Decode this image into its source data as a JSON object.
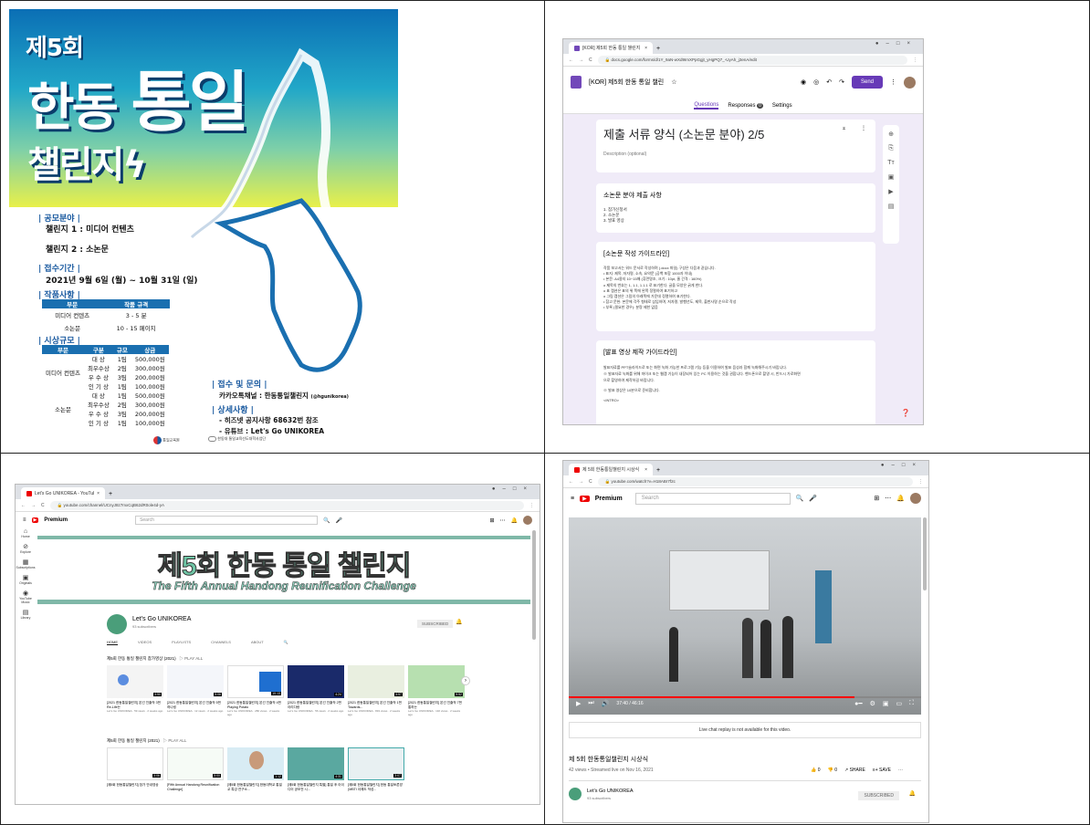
{
  "poster": {
    "round": "제5회",
    "title_a": "한동",
    "title_b": "통일",
    "title_c": "챌린지",
    "sec1": "| 공모분야 |",
    "ch1": "챌린지 1 : 미디어 컨텐츠",
    "ch2": "챌린지 2 : 소논문",
    "sec2": "| 접수기간 |",
    "period": "2021년 9월 6일 (월) ~ 10월 31일 (일)",
    "sec3": "| 작품사항 |",
    "spec_headers": [
      "부문",
      "작품 규격"
    ],
    "spec_rows": [
      [
        "미디어 컨텐츠",
        "3 - 5 분"
      ],
      [
        "소논문",
        "10 - 15 페이지"
      ]
    ],
    "sec4": "| 시상규모 |",
    "prize_headers": [
      "부문",
      "구분",
      "규모",
      "상금"
    ],
    "prize_media": "미디어 컨텐츠",
    "prize_paper": "소논문",
    "prize_rows": [
      [
        "대 상",
        "1팀",
        "500,000원"
      ],
      [
        "최우수상",
        "2팀",
        "300,000원"
      ],
      [
        "우 수 상",
        "3팀",
        "200,000원"
      ],
      [
        "인 기 상",
        "1팀",
        "100,000원"
      ]
    ],
    "sec5": "| 접수 및 문의 |",
    "contact": "카카오톡채널 : 한동통일챌린지",
    "contact_id": "(@hgunikorea)",
    "sec6": "| 상세사항 |",
    "detail1": "- 히즈넷 공지사항 68632번 참조",
    "detail2": "- 유튜브 : Let's Go UNIKOREA",
    "logo1": "통일교육원",
    "logo2": "한동대 통일교육선도대학사업단"
  },
  "forms": {
    "tab_title": "[KOR] 제5회 한동 통일 챌린지",
    "url": "docs.google.com/forms/d/1Y_9aN-wXd9ImXPpGgjt_yHgPQ7_-UyAh_j3enA/edit",
    "doc_title": "[KOR] 제5회 한동 통일 챌린",
    "send": "Send",
    "tab_questions": "Questions",
    "tab_responses": "Responses",
    "responses_count": "0",
    "tab_settings": "Settings",
    "section_title": "제출 서류 양식 (소논문 분야) 2/5",
    "description": "Description (optional)",
    "card1_title": "소논문 분야 제출 사항",
    "card1_items": [
      "1. 참가신청서",
      "2. 소논문",
      "3. 발표 영상"
    ],
    "card2_title": "[소논문 작성 가이드라인]",
    "card2_lines": [
      "작품 보고서는 워드 문서로 작성하며 (.docx 파일) 구성은 다음과 같습니다.",
      "• 표지: 제목, 저자명, 소속, 요약문 (공백 포함 1000자 이내)",
      "• 본문: A4용지 10~15매 (휴먼명조, 크기 : 10pt, 줄 간격 : 160%)",
      "o 제목의 번호는 1, 1.1, 1.1.1 로 표기한다. 글을 모양은 굵게 한다.",
      "o 표 캡션은 표의 위 쪽에 왼쪽 정렬하여 표기하고",
      "o 그림 캡션은 그림의 아래쪽에 가운데 정렬하여 표기한다.",
      "• 참고 문헌: 본문에 각주 형태로 삽입하며, 저자명, 발행년도, 제목, 출판사명 순으로 작성",
      "• 부록 (필요한 경우): 분량 제한 없음"
    ],
    "card3_title": "[발표 영상 제작 가이드라인]",
    "card3_lines": [
      "발표자료를 PPT슬라이드로 또는 화면 녹화 가능한 프로그램 기능 등을 이용하여 발표 음성과 함께 녹화해주시기 바랍니다.",
      "※ 발표자료 녹화를 위해 마이크 또는 웹캠 기능이 내장되어 있는 PC 이용하는 것을 권합니다. 핸드폰으로 촬영 시, 반드시 가로화면",
      "으로 촬영하여 제작하길 바랍니다.",
      "※ 발표 영상은 10분으로 준비합니다.",
      "<INTRO>"
    ]
  },
  "channel": {
    "tab_title": "Let's Go UNIKOREA - YouTube",
    "url": "youtube.com/channel/UCnyJ8z7mxCqB62dR0ole4d-yA",
    "premium": "Premium",
    "search_placeholder": "Search",
    "banner_title": "제5회 한동 통일 챌린지",
    "banner_sub": "The Fifth Annual Handong Reunification Challenge",
    "name": "Let's Go UNIKOREA",
    "subs": "93 subscribers",
    "subscribed": "SUBSCRIBED",
    "nav": [
      "Home",
      "Explore",
      "Subscriptions",
      "Originals",
      "YouTube Music",
      "Library"
    ],
    "tabs": [
      "HOME",
      "VIDEOS",
      "PLAYLISTS",
      "CHANNELS",
      "ABOUT"
    ],
    "playlist1": "제5회 한동 통일 챌린지 참가영상 (2021)",
    "playlist2": "제5회 한동 통일 챌린지 (2021)",
    "play_all": "PLAY ALL",
    "row1": [
      {
        "title": "[2021 한동통일챌린지] 본선 진출작 3번 Re-Life는",
        "meta": "Let's Go UNIKOREA · 59 views · 2 weeks ago",
        "dur": "4:50"
      },
      {
        "title": "[2021 한동통일챌린지] 본선 진출작 5번 하나링",
        "meta": "Let's Go UNIKOREA · 12 views · 2 weeks ago",
        "dur": "5:06"
      },
      {
        "title": "[2021 한동통일챌린지] 본선 진출작 4번 Playing Potato",
        "meta": "Let's Go UNIKOREA · 280 views · 2 weeks ago",
        "dur": "10:13"
      },
      {
        "title": "[2021 한동통일챌린지] 본선 진출작 2번 아리다랑",
        "meta": "Let's Go UNIKOREA · 56 views · 2 weeks ago",
        "dur": "4:24"
      },
      {
        "title": "[2021 한동통일챌린지] 본선 진출작 1번 Towards...",
        "meta": "Let's Go UNIKOREA · 819 views · 2 weeks ago",
        "dur": "4:57"
      },
      {
        "title": "[2021 한동통일챌린지] 본선 진출작 7번 통하는",
        "meta": "Let's Go UNIKOREA · 132 views · 2 weeks ago",
        "dur": "9:52"
      }
    ],
    "row2": [
      {
        "title": "[제5회 한동통일챌린지] 참가 안내영상",
        "meta": "",
        "dur": "4:06"
      },
      {
        "title": "[Fifth Annual Handong Reunification Challenge]",
        "meta": "",
        "dur": "5:00"
      },
      {
        "title": "[제5회 한동통일챌린지] 한동대학교 통일교 특강 연구소...",
        "meta": "",
        "dur": "1:12"
      },
      {
        "title": "[제5회 한동통일챌린지 특별] 통일 후 아이디어 공모전 시...",
        "meta": "",
        "dur": "4:31"
      },
      {
        "title": "[제5회 한동통일챌린지] 한동 통일토론방(MBTI 이해도 작성...",
        "meta": "",
        "dur": "3:07"
      }
    ]
  },
  "watch": {
    "tab_title": "제 5회 한동통일챌린지 시상식",
    "url": "youtube.com/watch?v=H18ABr7f2c",
    "premium": "Premium",
    "search_placeholder": "Search",
    "time": "37:40 / 46:16",
    "chat_note": "Live chat replay is not available for this video.",
    "title": "제 5회 한동통일챌린지 시상식",
    "meta": "42 views • Streamed live on Nov 16, 2021",
    "likes": "0",
    "dislikes": "0",
    "share": "SHARE",
    "save": "SAVE",
    "channel": "Let's Go UNIKOREA",
    "subs": "93 subscribers",
    "subscribed": "SUBSCRIBED",
    "avatar_text": "Let's Go UNIKOREA"
  }
}
